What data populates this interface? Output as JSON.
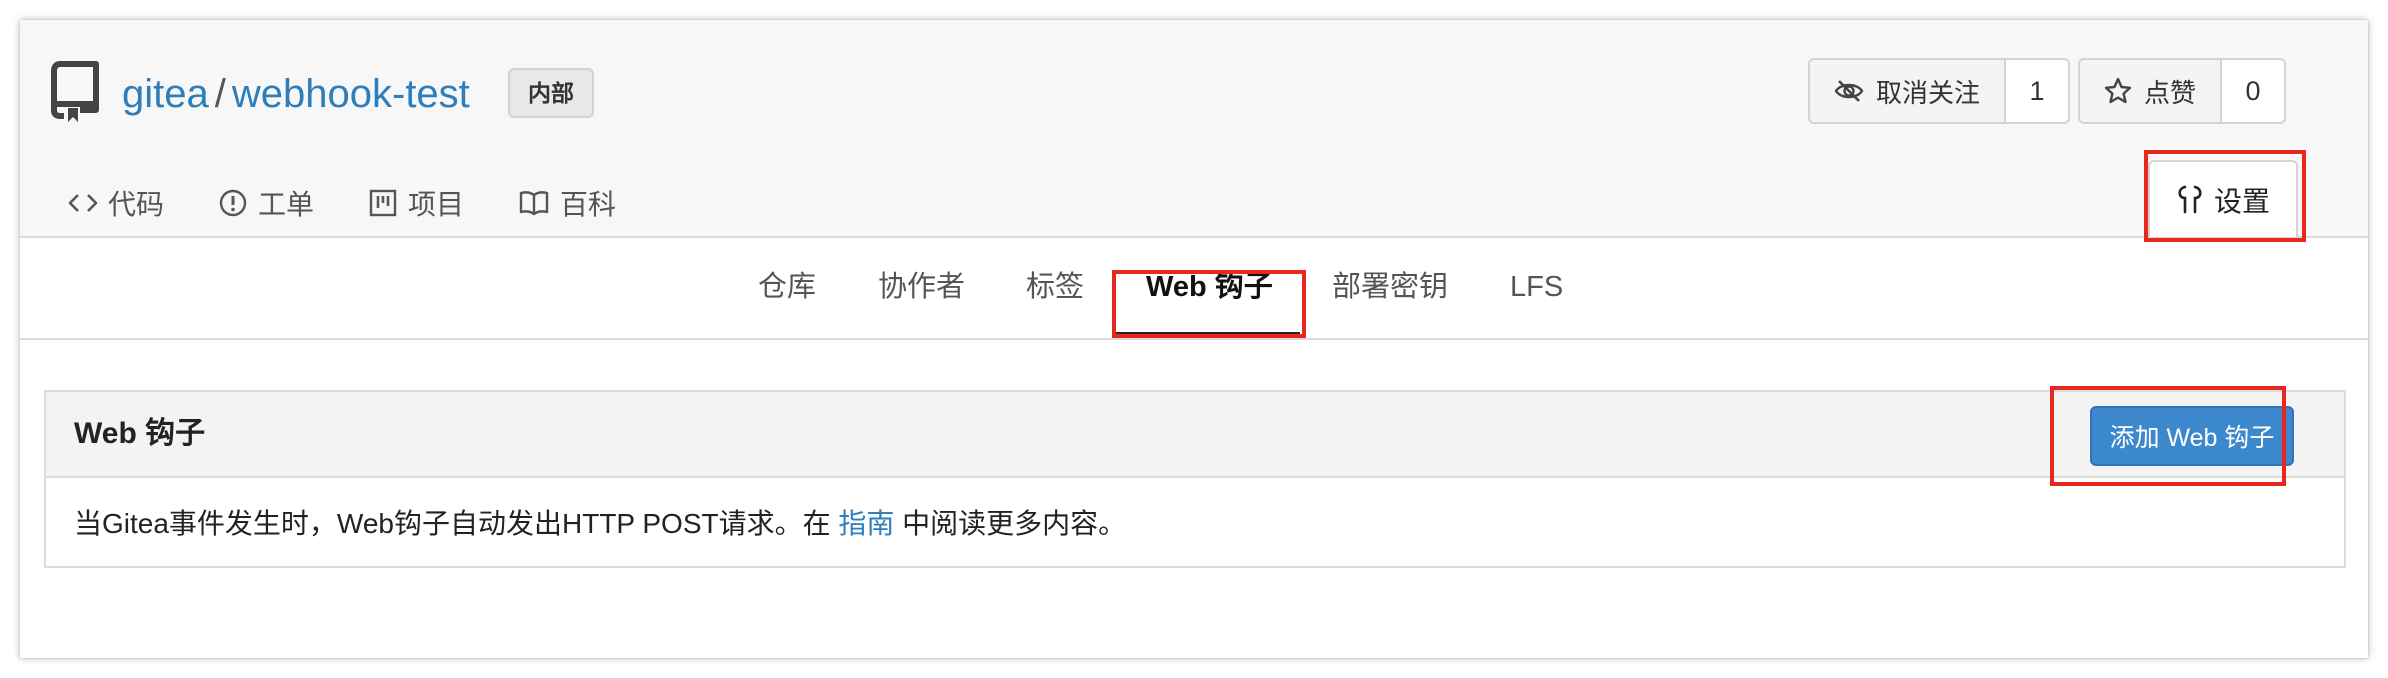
{
  "repo": {
    "owner": "gitea",
    "separator": "/",
    "name": "webhook-test",
    "visibility_badge": "内部"
  },
  "header_actions": {
    "unwatch_label": "取消关注",
    "watch_count": "1",
    "star_label": "点赞",
    "star_count": "0"
  },
  "repo_nav": {
    "code": "代码",
    "issues": "工单",
    "projects": "项目",
    "wiki": "百科",
    "settings": "设置"
  },
  "settings_nav": {
    "tabs": [
      "仓库",
      "协作者",
      "标签",
      "Web 钩子",
      "部署密钥",
      "LFS"
    ],
    "active": "Web 钩子"
  },
  "webhooks_panel": {
    "title": "Web 钩子",
    "add_button": "添加 Web 钩子",
    "description_before": "当Gitea事件发生时，Web钩子自动发出HTTP POST请求。在 ",
    "guide_link": "指南",
    "description_after": " 中阅读更多内容。"
  },
  "colors": {
    "link": "#2e7ebb",
    "primary_button": "#3b88cc",
    "highlight_box": "#e8281e"
  },
  "icons": [
    "repo-icon",
    "eye-slash-icon",
    "star-icon",
    "code-icon",
    "issue-icon",
    "project-icon",
    "book-icon",
    "tools-icon"
  ]
}
